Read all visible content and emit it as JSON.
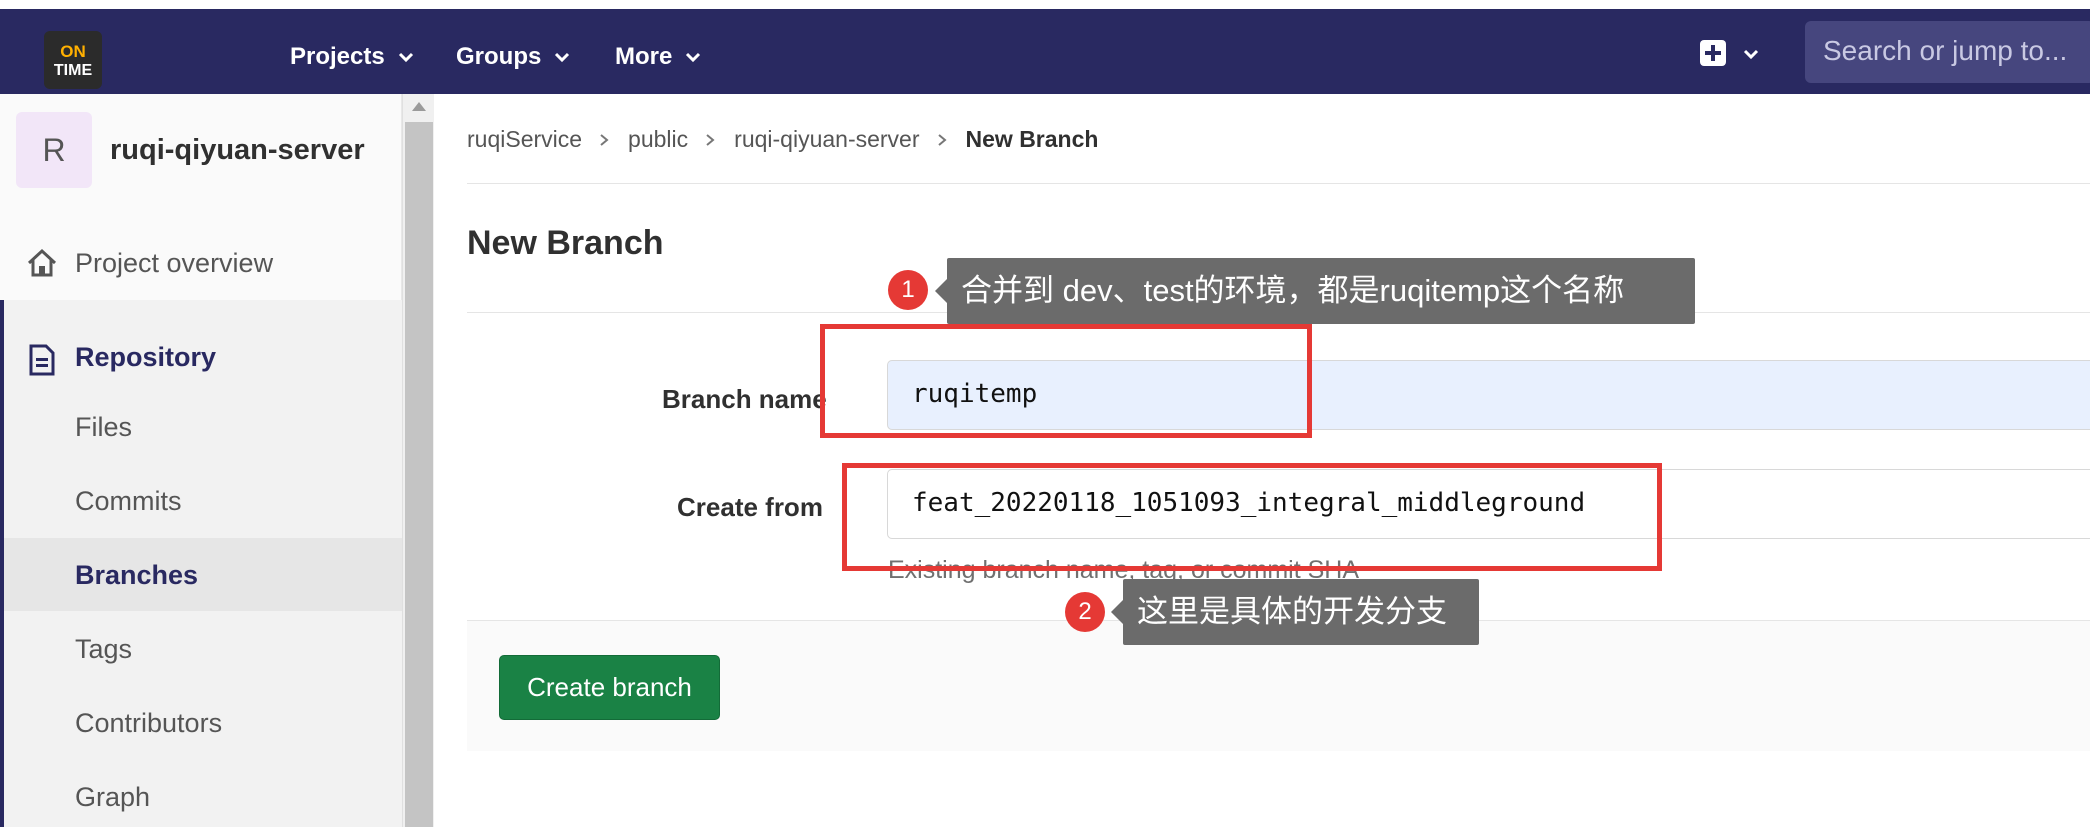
{
  "topbar": {
    "logo_on": "ON",
    "logo_time": "TIME",
    "nav": [
      "Projects",
      "Groups",
      "More"
    ],
    "search_placeholder": "Search or jump to..."
  },
  "sidebar": {
    "avatar_letter": "R",
    "project_name": "ruqi-qiyuan-server",
    "overview": "Project overview",
    "repository": "Repository",
    "items": [
      "Files",
      "Commits",
      "Branches",
      "Tags",
      "Contributors",
      "Graph"
    ],
    "active_item": "Branches"
  },
  "breadcrumb": [
    "ruqiService",
    "public",
    "ruqi-qiyuan-server",
    "New Branch"
  ],
  "page_title": "New Branch",
  "form": {
    "branch_label": "Branch name",
    "branch_value": "ruqitemp",
    "from_label": "Create from",
    "from_value": "feat_20220118_1051093_integral_middleground",
    "help_text": "Existing branch name, tag, or commit SHA",
    "submit_label": "Create branch"
  },
  "annotations": [
    {
      "number": "1",
      "text": "合并到 dev、test的环境，都是ruqitemp这个名称"
    },
    {
      "number": "2",
      "text": "这里是具体的开发分支"
    }
  ],
  "colors": {
    "topbar": "#292961",
    "accent": "#292961",
    "button": "#1a8245",
    "annotation": "#e53935"
  }
}
